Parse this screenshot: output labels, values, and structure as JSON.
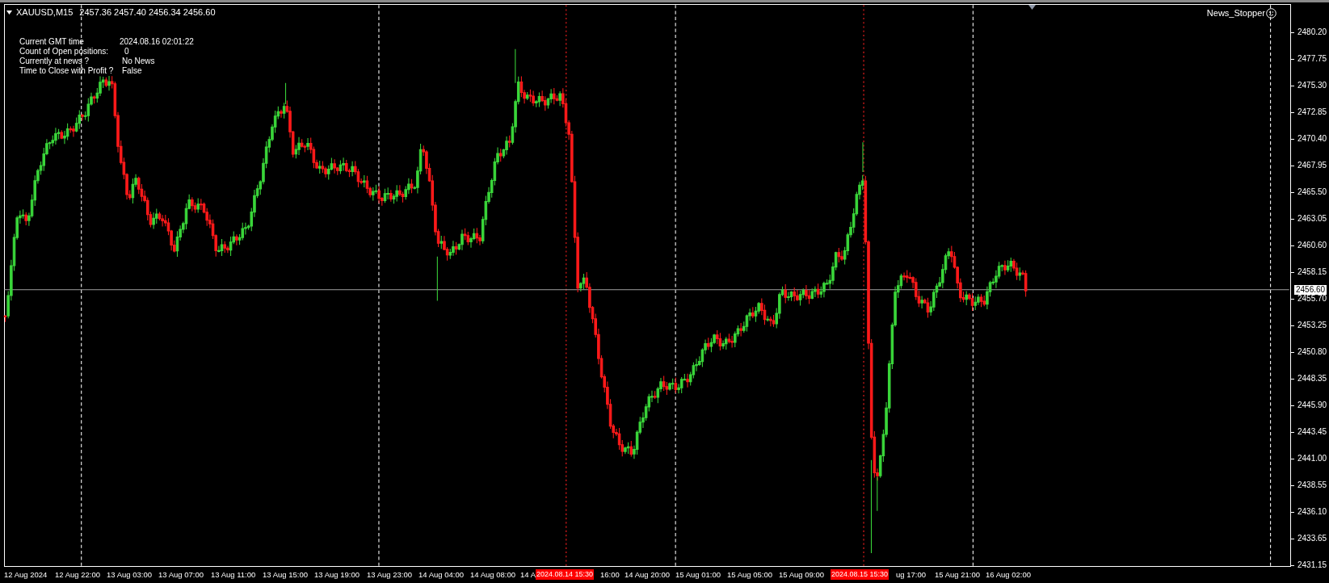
{
  "chart": {
    "symbol": "XAUUSD,M15",
    "ohlc": "2457.36 2457.40 2456.34 2456.60",
    "indicator_name": "News_Stopper",
    "info_panel": [
      {
        "label": "Current GMT time",
        "value": "2024.08.16 02:01:22"
      },
      {
        "label": "Count of Open positions:",
        "value": "0"
      },
      {
        "label": "Currently at news ?",
        "value": "No News"
      },
      {
        "label": "Time to Close with Profit ?",
        "value": "False"
      }
    ],
    "price_axis": [
      "2480.20",
      "2477.75",
      "2475.30",
      "2472.85",
      "2470.40",
      "2467.95",
      "2465.50",
      "2463.05",
      "2460.60",
      "2458.15",
      "2455.70",
      "2453.25",
      "2450.80",
      "2448.35",
      "2445.90",
      "2443.45",
      "2441.00",
      "2438.55",
      "2436.10",
      "2433.65",
      "2431.15"
    ],
    "current_price": "2456.60",
    "time_axis": [
      {
        "text": "12 Aug 2024",
        "kind": "label"
      },
      {
        "text": "12 Aug 22:00",
        "kind": "label"
      },
      {
        "text": "13 Aug 03:00",
        "kind": "label"
      },
      {
        "text": "13 Aug 07:00",
        "kind": "label"
      },
      {
        "text": "13 Aug 11:00",
        "kind": "label"
      },
      {
        "text": "13 Aug 15:00",
        "kind": "label"
      },
      {
        "text": "13 Aug 19:00",
        "kind": "label"
      },
      {
        "text": "13 Aug 23:00",
        "kind": "label"
      },
      {
        "text": "14 Aug 04:00",
        "kind": "label"
      },
      {
        "text": "14 Aug 08:00",
        "kind": "label"
      },
      {
        "text": "14 A",
        "kind": "label"
      },
      {
        "text": "2024.08.14 15:30",
        "kind": "news"
      },
      {
        "text": "16:00",
        "kind": "label"
      },
      {
        "text": "14 Aug 20:00",
        "kind": "label"
      },
      {
        "text": "15 Aug 01:00",
        "kind": "label"
      },
      {
        "text": "15 Aug 05:00",
        "kind": "label"
      },
      {
        "text": "15 Aug 09:00",
        "kind": "label"
      },
      {
        "text": "2024.08.15 15:30",
        "kind": "news"
      },
      {
        "text": "ug 17:00",
        "kind": "label"
      },
      {
        "text": "15 Aug 21:00",
        "kind": "label"
      },
      {
        "text": "16 Aug 02:00",
        "kind": "label"
      }
    ]
  }
}
